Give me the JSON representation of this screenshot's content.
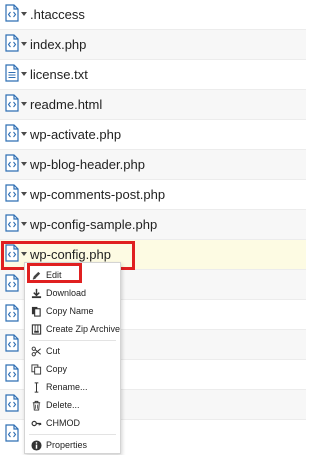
{
  "files": [
    {
      "name": ".htaccess",
      "type": "code"
    },
    {
      "name": "index.php",
      "type": "code"
    },
    {
      "name": "license.txt",
      "type": "text"
    },
    {
      "name": "readme.html",
      "type": "code"
    },
    {
      "name": "wp-activate.php",
      "type": "code"
    },
    {
      "name": "wp-blog-header.php",
      "type": "code"
    },
    {
      "name": "wp-comments-post.php",
      "type": "code"
    },
    {
      "name": "wp-config-sample.php",
      "type": "code"
    },
    {
      "name": "wp-config.php",
      "type": "code",
      "selected": true
    }
  ],
  "context_menu": {
    "items": [
      {
        "label": "Edit",
        "icon": "pencil-icon"
      },
      {
        "label": "Download",
        "icon": "download-icon"
      },
      {
        "label": "Copy Name",
        "icon": "copy-name-icon"
      },
      {
        "label": "Create Zip Archive",
        "icon": "archive-icon"
      },
      {
        "label": "Cut",
        "icon": "scissors-icon"
      },
      {
        "label": "Copy",
        "icon": "copy-icon"
      },
      {
        "label": "Rename...",
        "icon": "rename-icon"
      },
      {
        "label": "Delete...",
        "icon": "trash-icon"
      },
      {
        "label": "CHMOD",
        "icon": "key-icon"
      },
      {
        "label": "Properties",
        "icon": "info-icon"
      }
    ]
  },
  "colors": {
    "icon_blue": "#2f6fb4",
    "highlight_red": "#e02020",
    "selected_row": "#fdfbe3"
  }
}
